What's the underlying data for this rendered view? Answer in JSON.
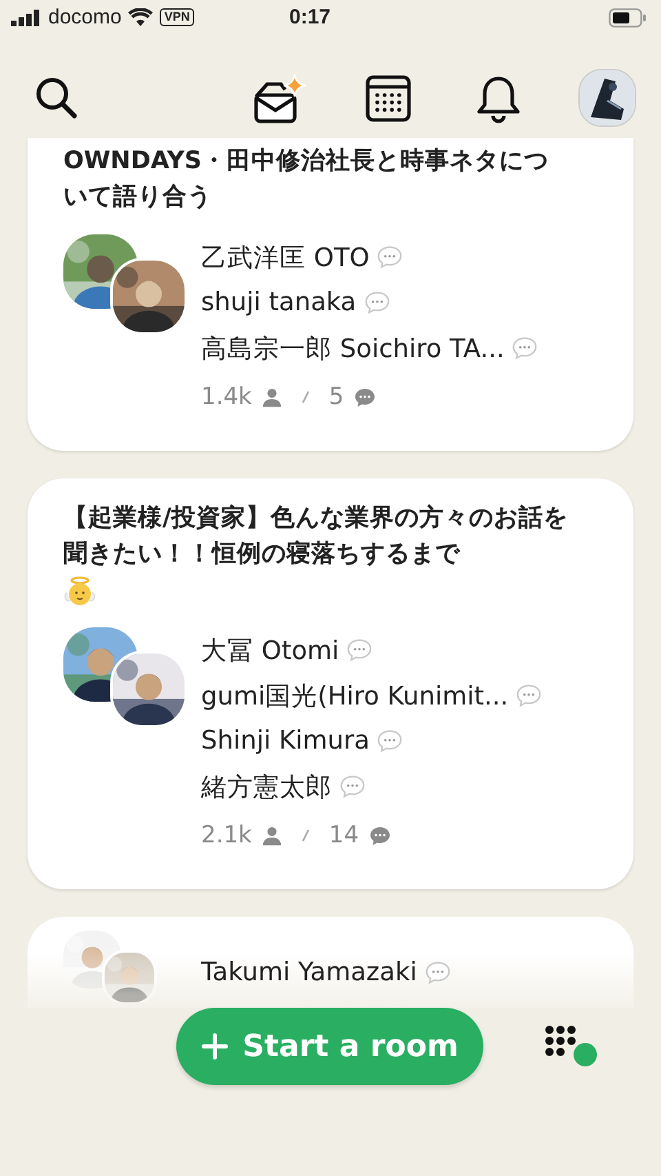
{
  "status_bar": {
    "carrier": "docomo",
    "vpn": "VPN",
    "time": "0:17"
  },
  "rooms": [
    {
      "title": "OWNDAYS・田中修治社長と時事ネタについて語り合う",
      "title_icon": false,
      "speakers": [
        {
          "name": "乙武洋匡 OTO"
        },
        {
          "name": "shuji tanaka"
        },
        {
          "name": "高島宗一郎 Soichiro TA..."
        }
      ],
      "listeners": "1.4k",
      "speaker_count": "5"
    },
    {
      "title": "【起業様/投資家】色んな業界の方々のお話を聞きたい！！恒例の寝落ちするまで",
      "title_icon": true,
      "speakers": [
        {
          "name": "大冨 Otomi"
        },
        {
          "name": "gumi国光(Hiro Kunimit..."
        },
        {
          "name": "Shinji Kimura"
        },
        {
          "name": "緒方憲太郎"
        }
      ],
      "listeners": "2.1k",
      "speaker_count": "14"
    },
    {
      "speakers": [
        {
          "name": "Takumi Yamazaki"
        }
      ]
    }
  ],
  "start_button": {
    "label": "Start a room"
  }
}
